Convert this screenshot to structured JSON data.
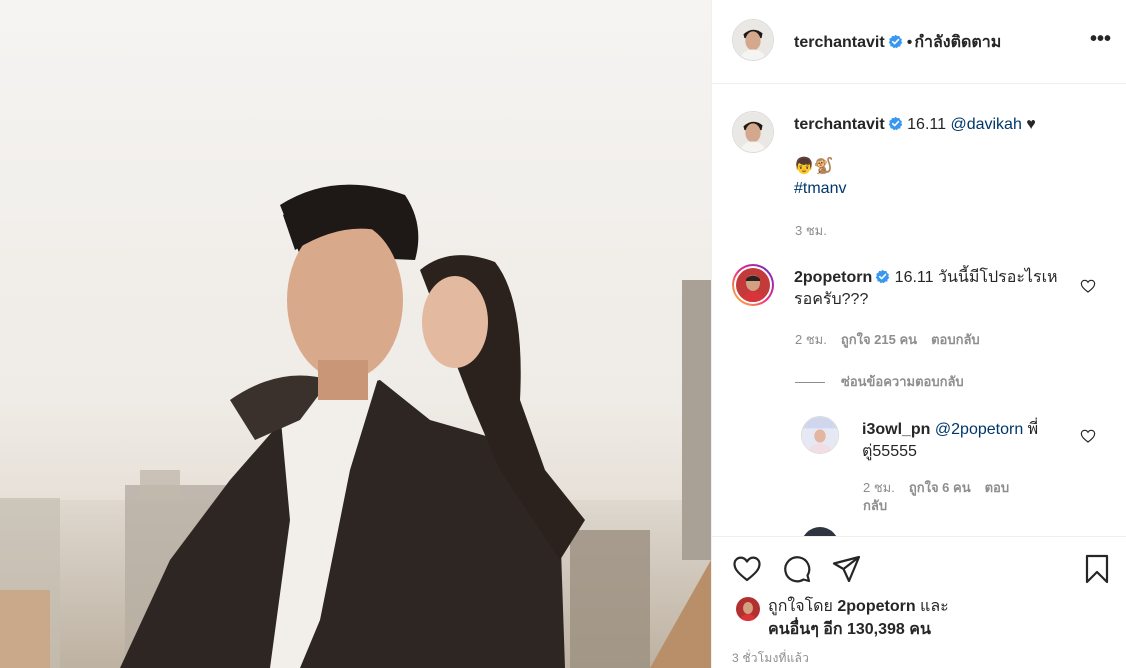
{
  "post": {
    "author": "terchantavit",
    "follow_status": "กำลังติดตาม",
    "more_label": "•••"
  },
  "caption": {
    "author": "terchantavit",
    "text_prefix": "16.11 ",
    "mention": "@davikah",
    "suffix": " ♥",
    "emoji_line": "👦🐒",
    "hashtag": "#tmanv",
    "time": "3 ชม."
  },
  "comments": [
    {
      "author": "2popetorn",
      "text": "16.11 วันนี้มีโปรอะไรเหรอครับ???",
      "time": "2 ชม.",
      "likes": "ถูกใจ 215 คน",
      "reply_label": "ตอบกลับ"
    }
  ],
  "hide_replies_label": "ซ่อนข้อความตอบกลับ",
  "replies": [
    {
      "author": "i3owl_pn",
      "mention": "@2popetorn",
      "text_after": " พี่ตู่55555",
      "time": "2 ชม.",
      "likes": "ถูกใจ 6 คน",
      "reply_label": "ตอบกลับ"
    }
  ],
  "likes": {
    "prefix": "ถูกใจโดย ",
    "user": "2popetorn",
    "middle": " และ",
    "line2": "คนอื่นๆ อีก 130,398 คน"
  },
  "posted_ago": "3 ชั่วโมงที่แล้ว",
  "colors": {
    "verified": "#3897f0",
    "link": "#00376b",
    "meta": "#8e8e8e"
  }
}
